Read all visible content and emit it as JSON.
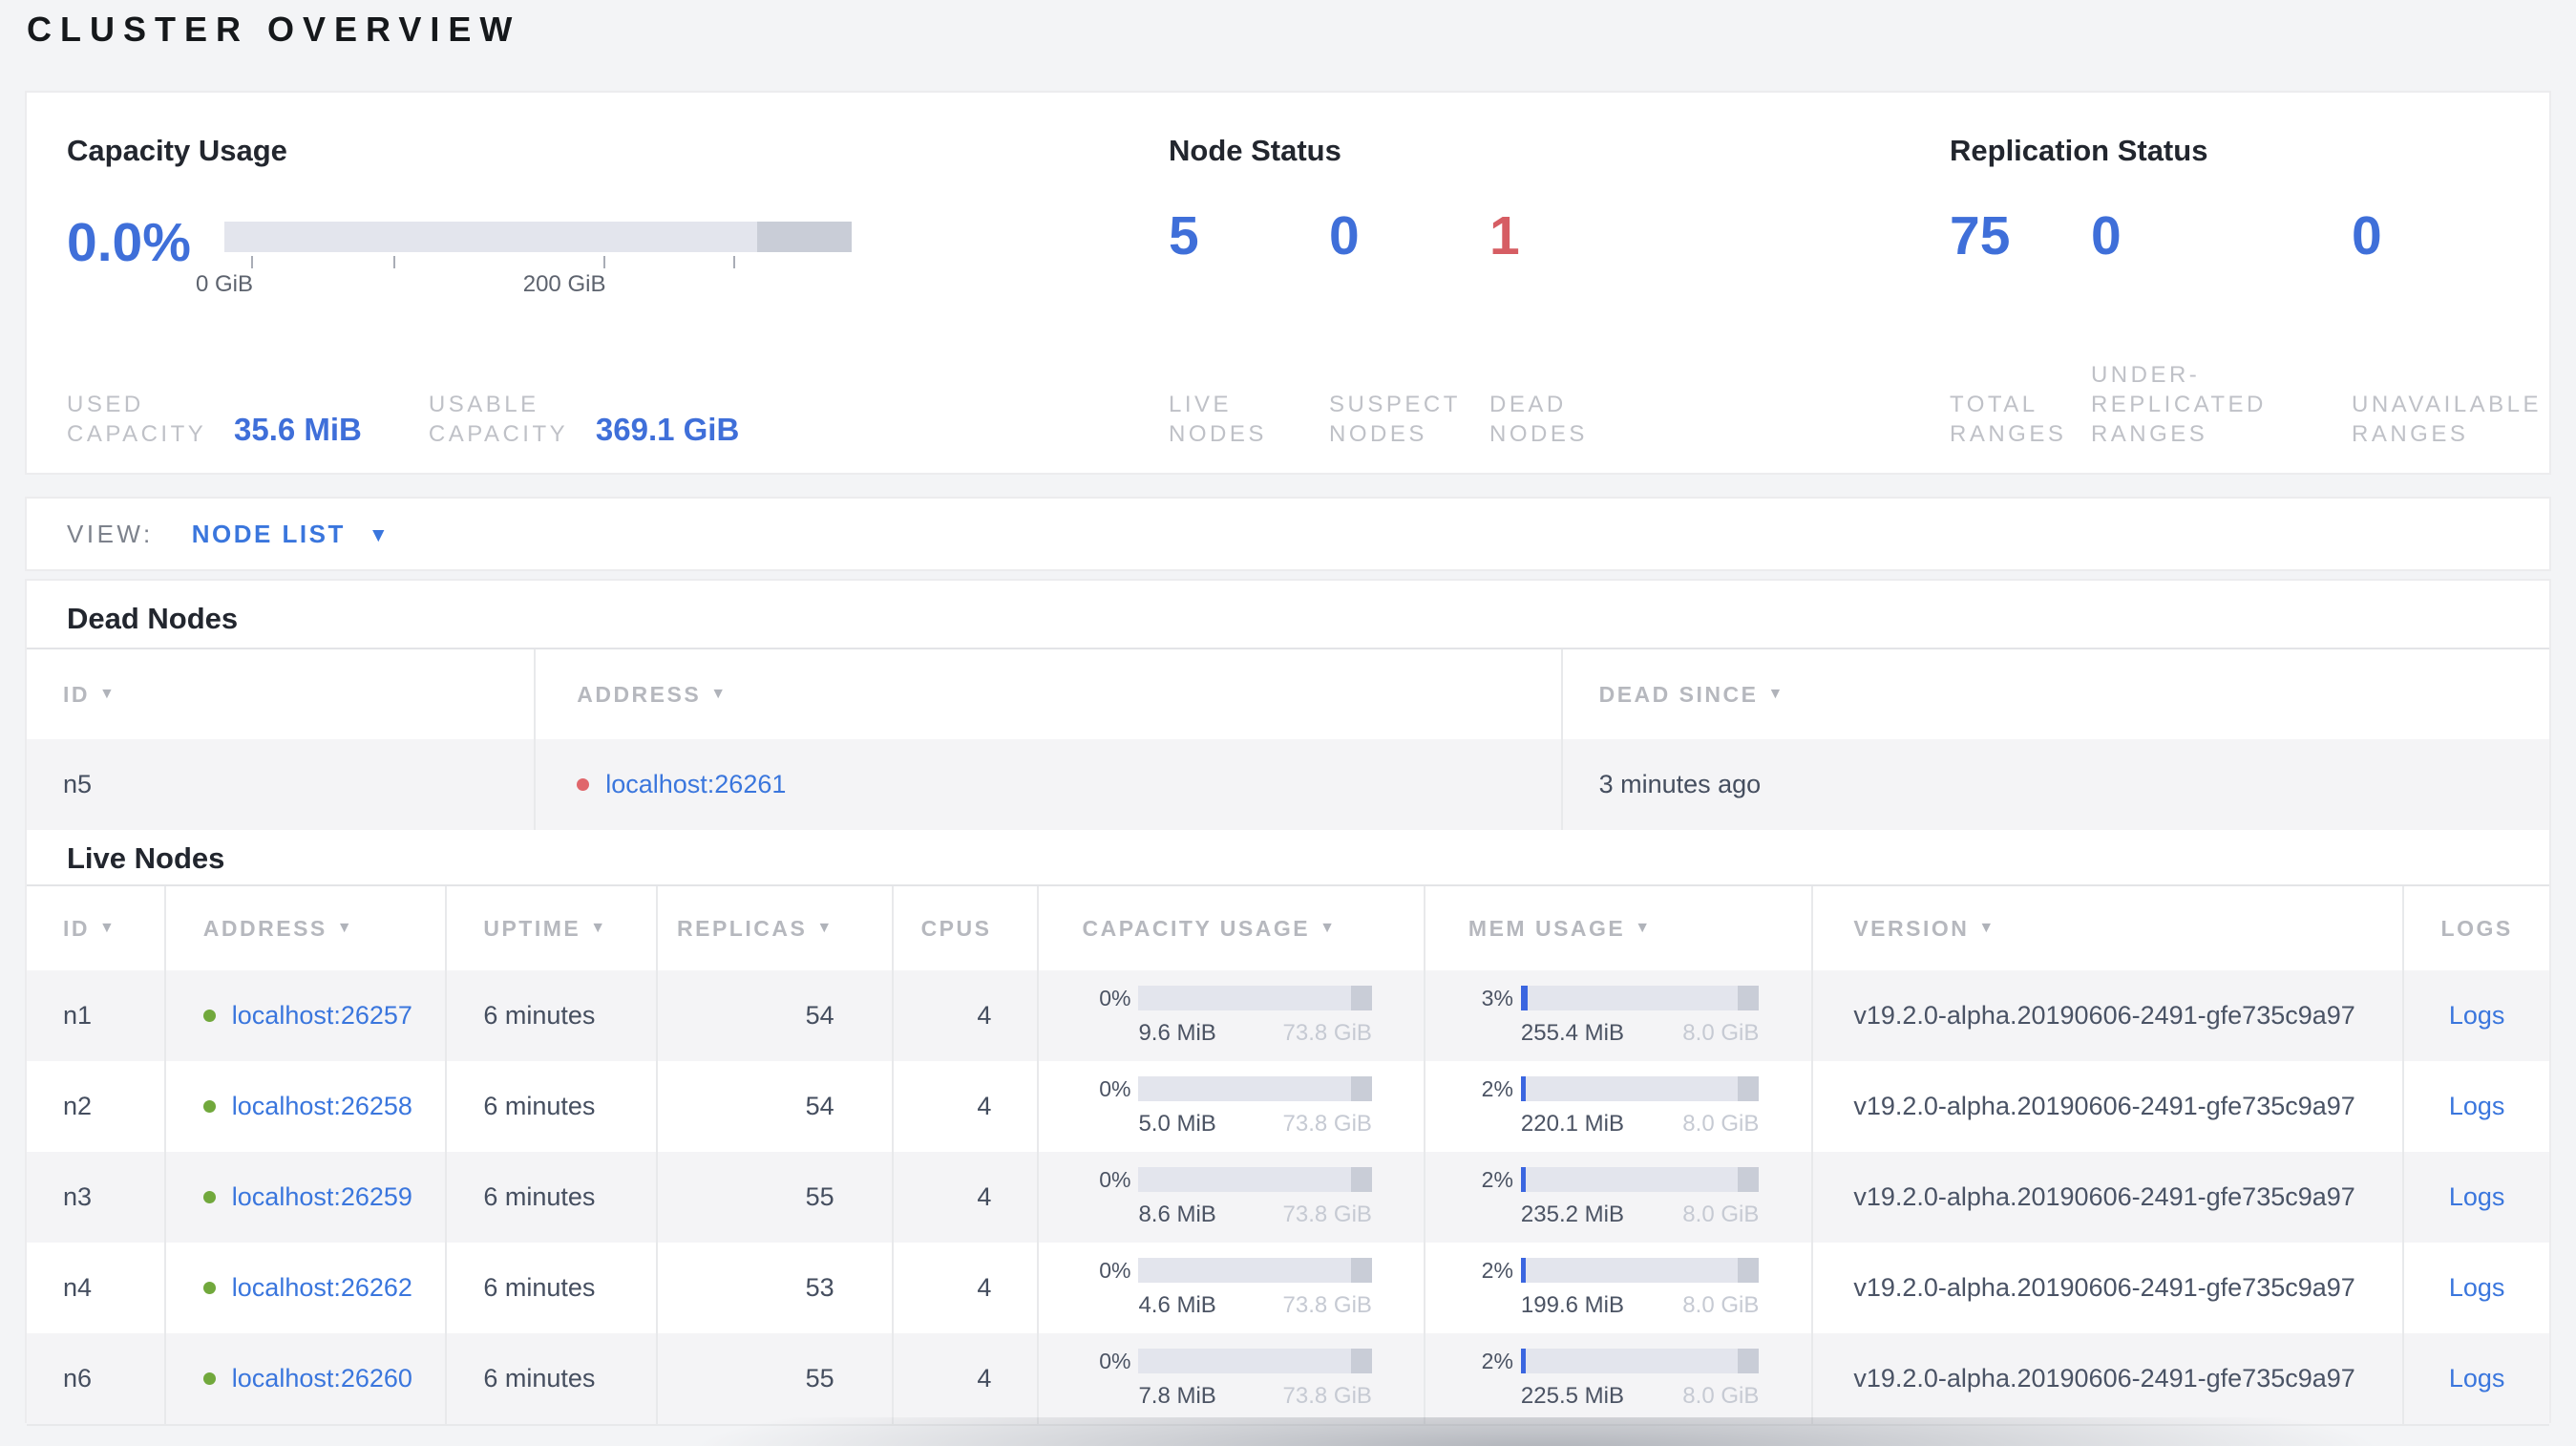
{
  "page": {
    "title": "CLUSTER OVERVIEW"
  },
  "colors": {
    "accent_blue": "#3f6fd9",
    "link_blue": "#3a76dd",
    "danger_red": "#d65d63",
    "live_green": "#71a83c",
    "bar_track": "#e3e5ed",
    "bar_dark": "#c9cdd7",
    "bar_fill_blue": "#3b66e0"
  },
  "overview": {
    "capacity": {
      "title": "Capacity Usage",
      "percent": "0.0%",
      "used_label": "USED CAPACITY",
      "used_value": "35.6 MiB",
      "usable_label": "USABLE CAPACITY",
      "usable_value": "369.1 GiB",
      "bar": {
        "fill_pct": 0,
        "ticks": [
          {
            "label": "0 GiB",
            "pos_pct": 0
          },
          {
            "label": "",
            "pos_pct": 27.1
          },
          {
            "label": "200 GiB",
            "pos_pct": 54.2
          },
          {
            "label": "",
            "pos_pct": 81.3
          }
        ]
      }
    },
    "node_status": {
      "title": "Node Status",
      "stats": [
        {
          "value": "5",
          "label": "LIVE NODES",
          "state": "live"
        },
        {
          "value": "0",
          "label": "SUSPECT NODES",
          "state": "suspect"
        },
        {
          "value": "1",
          "label": "DEAD NODES",
          "state": "dead"
        }
      ]
    },
    "replication_status": {
      "title": "Replication Status",
      "stats": [
        {
          "value": "75",
          "label": "TOTAL RANGES",
          "state": "normal"
        },
        {
          "value": "0",
          "label": "UNDER-REPLICATED RANGES",
          "state": "normal"
        },
        {
          "value": "0",
          "label": "UNAVAILABLE RANGES",
          "state": "normal"
        }
      ]
    }
  },
  "view_bar": {
    "label": "VIEW:",
    "selected": "NODE LIST",
    "caret": "▼"
  },
  "dead_nodes": {
    "title": "Dead Nodes",
    "columns": [
      {
        "label": "ID",
        "arrow": "▼"
      },
      {
        "label": "ADDRESS",
        "arrow": "▼"
      },
      {
        "label": "DEAD SINCE",
        "arrow": "▼"
      }
    ],
    "rows": [
      {
        "id": "n5",
        "address": "localhost:26261",
        "dead_since": "3 minutes ago"
      }
    ]
  },
  "live_nodes": {
    "title": "Live Nodes",
    "columns": [
      {
        "label": "ID",
        "arrow": "▼"
      },
      {
        "label": "ADDRESS",
        "arrow": "▼"
      },
      {
        "label": "UPTIME",
        "arrow": "▼"
      },
      {
        "label": "REPLICAS",
        "arrow": "▼"
      },
      {
        "label": "CPUS",
        "arrow": ""
      },
      {
        "label": "CAPACITY USAGE",
        "arrow": "▼"
      },
      {
        "label": "MEM USAGE",
        "arrow": "▼"
      },
      {
        "label": "VERSION",
        "arrow": "▼"
      },
      {
        "label": "LOGS",
        "arrow": ""
      }
    ],
    "rows": [
      {
        "id": "n1",
        "address": "localhost:26257",
        "uptime": "6 minutes",
        "replicas": "54",
        "cpus": "4",
        "cap_pct": "0%",
        "cap_fill": 0,
        "cap_used": "9.6 MiB",
        "cap_total": "73.8 GiB",
        "mem_pct": "3%",
        "mem_fill": 3,
        "mem_used": "255.4 MiB",
        "mem_total": "8.0 GiB",
        "version": "v19.2.0-alpha.20190606-2491-gfe735c9a97",
        "logs": "Logs"
      },
      {
        "id": "n2",
        "address": "localhost:26258",
        "uptime": "6 minutes",
        "replicas": "54",
        "cpus": "4",
        "cap_pct": "0%",
        "cap_fill": 0,
        "cap_used": "5.0 MiB",
        "cap_total": "73.8 GiB",
        "mem_pct": "2%",
        "mem_fill": 2,
        "mem_used": "220.1 MiB",
        "mem_total": "8.0 GiB",
        "version": "v19.2.0-alpha.20190606-2491-gfe735c9a97",
        "logs": "Logs"
      },
      {
        "id": "n3",
        "address": "localhost:26259",
        "uptime": "6 minutes",
        "replicas": "55",
        "cpus": "4",
        "cap_pct": "0%",
        "cap_fill": 0,
        "cap_used": "8.6 MiB",
        "cap_total": "73.8 GiB",
        "mem_pct": "2%",
        "mem_fill": 2,
        "mem_used": "235.2 MiB",
        "mem_total": "8.0 GiB",
        "version": "v19.2.0-alpha.20190606-2491-gfe735c9a97",
        "logs": "Logs"
      },
      {
        "id": "n4",
        "address": "localhost:26262",
        "uptime": "6 minutes",
        "replicas": "53",
        "cpus": "4",
        "cap_pct": "0%",
        "cap_fill": 0,
        "cap_used": "4.6 MiB",
        "cap_total": "73.8 GiB",
        "mem_pct": "2%",
        "mem_fill": 2,
        "mem_used": "199.6 MiB",
        "mem_total": "8.0 GiB",
        "version": "v19.2.0-alpha.20190606-2491-gfe735c9a97",
        "logs": "Logs"
      },
      {
        "id": "n6",
        "address": "localhost:26260",
        "uptime": "6 minutes",
        "replicas": "55",
        "cpus": "4",
        "cap_pct": "0%",
        "cap_fill": 0,
        "cap_used": "7.8 MiB",
        "cap_total": "73.8 GiB",
        "mem_pct": "2%",
        "mem_fill": 2,
        "mem_used": "225.5 MiB",
        "mem_total": "8.0 GiB",
        "version": "v19.2.0-alpha.20190606-2491-gfe735c9a97",
        "logs": "Logs"
      }
    ]
  }
}
